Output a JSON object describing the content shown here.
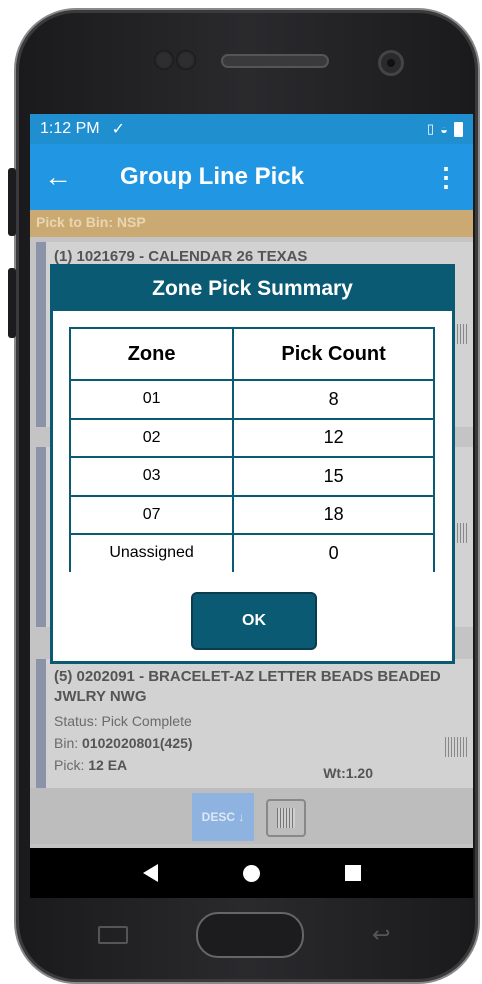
{
  "status_bar": {
    "time": "1:12 PM",
    "check_glyph": "✓"
  },
  "app_bar": {
    "title": "Group Line Pick",
    "back_glyph": "←",
    "more_glyph": "⋮"
  },
  "pick_to_bin": "Pick to Bin: NSP",
  "cards": {
    "first_title": "(1) 1021679 - CALENDAR 26 TEXAS",
    "last": {
      "title": "(5) 0202091 - BRACELET-AZ LETTER BEADS BEADED JWLRY NWG",
      "status_label": "Status:",
      "status_value": "Pick Complete",
      "bin_label": "Bin:",
      "bin_value": "0102020801(425)",
      "pick_label": "Pick:",
      "pick_value": "12 EA",
      "wt": "Wt:1.20"
    }
  },
  "bottom_bar": {
    "desc_label": "DESC ↓"
  },
  "dialog": {
    "title": "Zone Pick Summary",
    "headers": {
      "zone": "Zone",
      "count": "Pick Count"
    },
    "rows": [
      {
        "zone": "01",
        "count": "8"
      },
      {
        "zone": "02",
        "count": "12"
      },
      {
        "zone": "03",
        "count": "15"
      },
      {
        "zone": "07",
        "count": "18"
      },
      {
        "zone": "Unassigned",
        "count": "0"
      }
    ],
    "ok_label": "OK"
  }
}
